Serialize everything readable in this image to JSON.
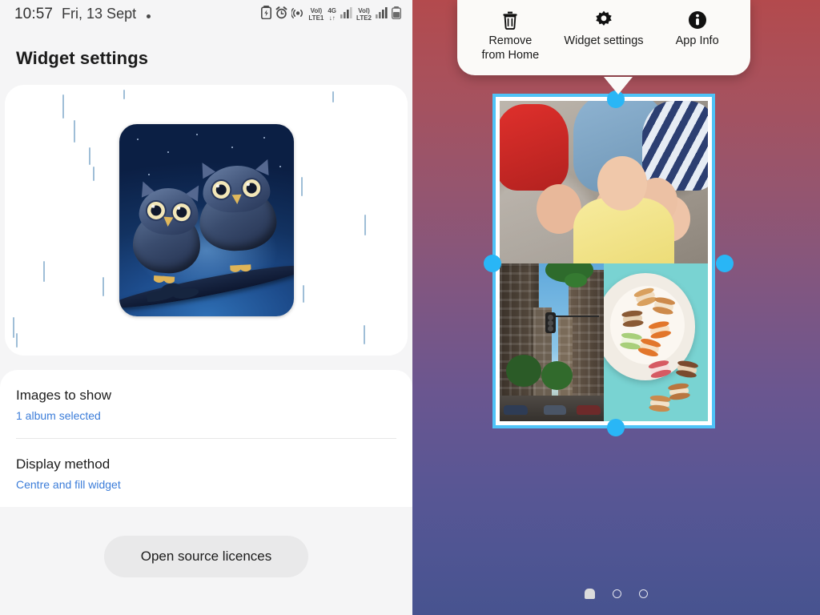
{
  "status_bar": {
    "time": "10:57",
    "date": "Fri, 13 Sept",
    "separator_dot": "•",
    "icons": [
      {
        "name": "battery-saver-icon",
        "label": ""
      },
      {
        "name": "alarm-icon",
        "label": ""
      },
      {
        "name": "hotspot-icon",
        "label": ""
      },
      {
        "name": "volte-lte1-icon",
        "line1": "VoI)",
        "line2": "LTE1"
      },
      {
        "name": "data-4g-icon",
        "line1": "4G",
        "line2": "↓↑"
      },
      {
        "name": "signal-bars-1-icon",
        "label": ""
      },
      {
        "name": "volte-lte2-icon",
        "line1": "VoI)",
        "line2": "LTE2"
      },
      {
        "name": "signal-bars-2-icon",
        "label": ""
      },
      {
        "name": "battery-icon",
        "label": ""
      }
    ]
  },
  "app": {
    "title": "Widget settings",
    "preview": {
      "description": "Two owls perched on a branch under a blue night sky",
      "background": "white with blue rain streaks"
    },
    "settings": [
      {
        "title": "Images to show",
        "value": "1 album selected"
      },
      {
        "title": "Display method",
        "value": "Centre and fill widget"
      }
    ],
    "licence_button": "Open source licences"
  },
  "home_screen": {
    "popup": {
      "items": [
        {
          "label": "Remove\nfrom Home",
          "icon": "trash-icon"
        },
        {
          "label": "Widget settings",
          "icon": "gear-icon"
        },
        {
          "label": "App Info",
          "icon": "info-icon"
        }
      ]
    },
    "widget": {
      "name": "photo-collage-widget",
      "selected": true,
      "photos": [
        {
          "name": "family-photo",
          "description": "Family lying on the ground smiling"
        },
        {
          "name": "city-street-photo",
          "description": "City street with traffic light"
        },
        {
          "name": "macarons-photo",
          "description": "Macarons on a white plate"
        }
      ],
      "handles": [
        "top",
        "bottom",
        "left",
        "right"
      ]
    },
    "page_indicator": {
      "pages": [
        "home",
        "page-2",
        "page-3"
      ],
      "active": "home"
    }
  },
  "colors": {
    "accent_link": "#3c7dd9",
    "selection_border": "#4fc3f7",
    "handle": "#29b6f6",
    "wallpaper_top": "#b34a4d",
    "wallpaper_bottom": "#47538f"
  }
}
